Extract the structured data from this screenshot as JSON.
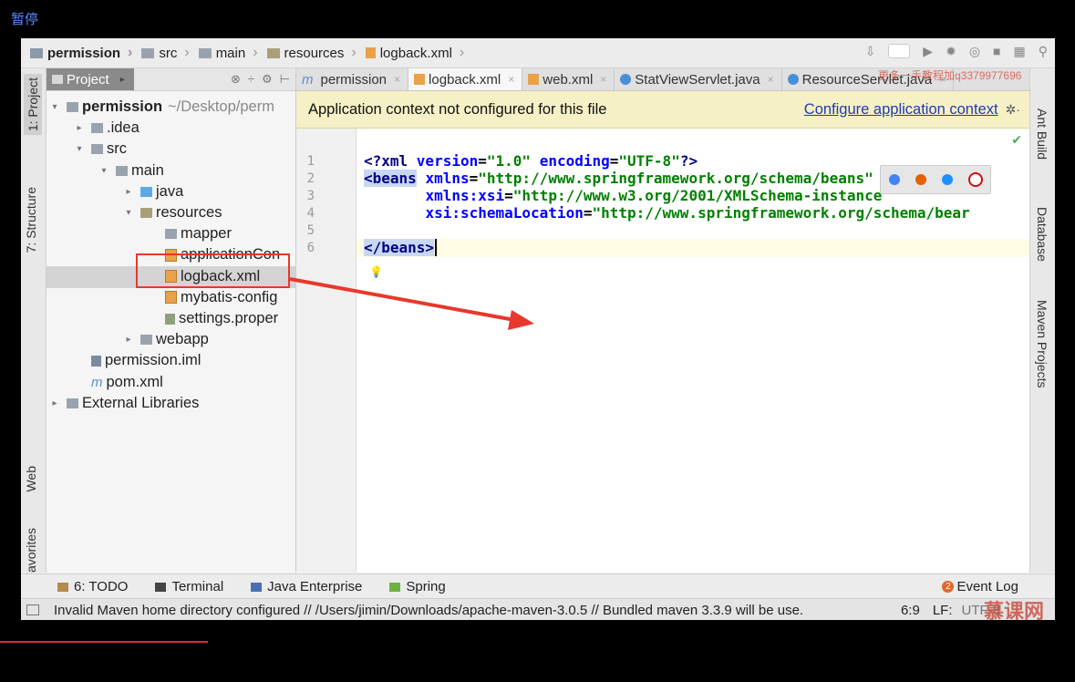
{
  "overlay": {
    "pause_label": "暂停"
  },
  "breadcrumb": [
    "permission",
    "src",
    "main",
    "resources",
    "logback.xml"
  ],
  "project_panel": {
    "tab_label": "Project",
    "tree": [
      {
        "label": "permission",
        "suffix": "~/Desktop/perm",
        "depth": 0,
        "arrow": "▾",
        "bold": true,
        "icon": "module-icon"
      },
      {
        "label": ".idea",
        "depth": 1,
        "arrow": "▸",
        "icon": "folder-icon"
      },
      {
        "label": "src",
        "depth": 1,
        "arrow": "▾",
        "icon": "folder-icon"
      },
      {
        "label": "main",
        "depth": 2,
        "arrow": "▾",
        "icon": "folder-icon"
      },
      {
        "label": "java",
        "depth": 3,
        "arrow": "▸",
        "icon": "source-folder-icon"
      },
      {
        "label": "resources",
        "depth": 3,
        "arrow": "▾",
        "icon": "resources-folder-icon"
      },
      {
        "label": "mapper",
        "depth": 4,
        "arrow": "",
        "icon": "folder-icon"
      },
      {
        "label": "applicationCon",
        "depth": 4,
        "arrow": "",
        "icon": "xml-file-icon"
      },
      {
        "label": "logback.xml",
        "depth": 4,
        "arrow": "",
        "icon": "xml-file-icon"
      },
      {
        "label": "mybatis-config",
        "depth": 4,
        "arrow": "",
        "icon": "xml-file-icon"
      },
      {
        "label": "settings.proper",
        "depth": 4,
        "arrow": "",
        "icon": "properties-file-icon"
      },
      {
        "label": "webapp",
        "depth": 3,
        "arrow": "▸",
        "icon": "folder-icon"
      },
      {
        "label": "permission.iml",
        "depth": 1,
        "arrow": "",
        "icon": "iml-file-icon"
      },
      {
        "label": "pom.xml",
        "depth": 1,
        "arrow": "",
        "icon": "maven-file-icon"
      },
      {
        "label": "External Libraries",
        "depth": 0,
        "arrow": "▸",
        "icon": "libraries-icon"
      }
    ]
  },
  "left_strip": {
    "project": "1: Project",
    "structure": "7: Structure",
    "web": "Web",
    "favorites": "Favorites"
  },
  "right_strip": {
    "ant": "Ant Build",
    "database": "Database",
    "maven": "Maven Projects"
  },
  "editor_tabs": [
    {
      "label": "permission",
      "icon": "maven-file-icon"
    },
    {
      "label": "logback.xml",
      "icon": "xml-file-icon",
      "active": true
    },
    {
      "label": "web.xml",
      "icon": "xml-file-icon"
    },
    {
      "label": "StatViewServlet.java",
      "icon": "class-icon"
    },
    {
      "label": "ResourceServlet.java",
      "icon": "class-icon"
    }
  ],
  "watermark_top": "更多一手教程加q3379977696",
  "banner": {
    "message": "Application context not configured for this file",
    "link": "Configure application context"
  },
  "editor": {
    "line_numbers": [
      "1",
      "2",
      "3",
      "4",
      "5",
      "6"
    ]
  },
  "bottom_tools": [
    {
      "label": "6: TODO",
      "icon": "todo-icon"
    },
    {
      "label": "Terminal",
      "icon": "terminal-icon"
    },
    {
      "label": "Java Enterprise",
      "icon": "java-enterprise-icon"
    },
    {
      "label": "Spring",
      "icon": "spring-icon"
    }
  ],
  "event_log": {
    "count": "2",
    "label": "Event Log"
  },
  "status": {
    "message": "Invalid Maven home directory configured // /Users/jimin/Downloads/apache-maven-3.0.5 // Bundled maven 3.3.9 will be use.",
    "position": "6:9",
    "line_sep": "LF:",
    "encoding": "UTF-8",
    "watermark_logo": "慕课网"
  },
  "colors": {
    "accent_link": "#1f3cb5",
    "annotation": "#e8382c",
    "banner_bg": "#f5f0c6"
  }
}
